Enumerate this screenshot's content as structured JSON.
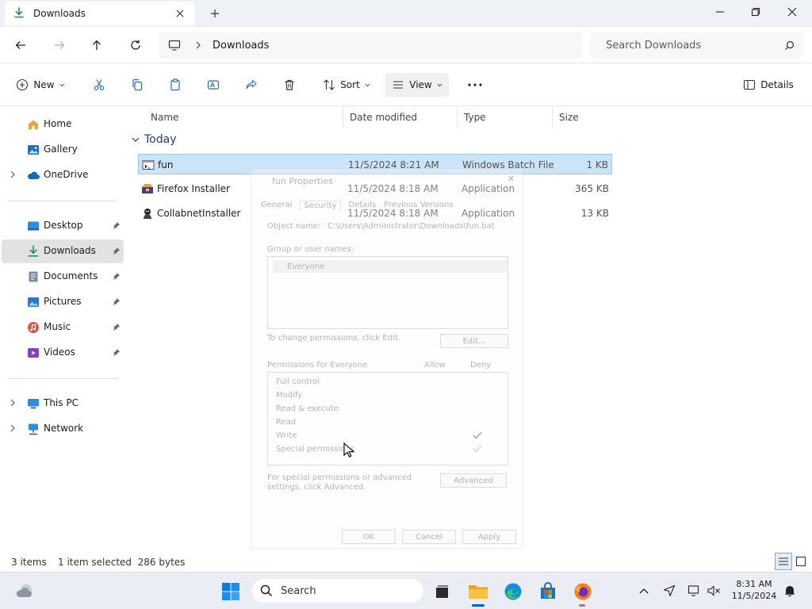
{
  "window": {
    "tab_title": "Downloads",
    "tab_icon": "downloads-arrow-icon",
    "controls": [
      "minimize-icon",
      "maximize-icon",
      "close-icon"
    ]
  },
  "address": {
    "breadcrumb": "Downloads",
    "search_placeholder": "Search Downloads"
  },
  "toolbar": {
    "new_label": "New",
    "sort_label": "Sort",
    "view_label": "View",
    "details_label": "Details"
  },
  "sidebar": {
    "quick": [
      {
        "label": "Home",
        "icon": "home-icon"
      },
      {
        "label": "Gallery",
        "icon": "gallery-icon"
      },
      {
        "label": "OneDrive",
        "icon": "onedrive-cloud-icon"
      }
    ],
    "pinned": [
      {
        "label": "Desktop",
        "icon": "desktop-icon"
      },
      {
        "label": "Downloads",
        "icon": "downloads-icon"
      },
      {
        "label": "Documents",
        "icon": "documents-icon"
      },
      {
        "label": "Pictures",
        "icon": "pictures-icon"
      },
      {
        "label": "Music",
        "icon": "music-icon"
      },
      {
        "label": "Videos",
        "icon": "videos-icon"
      }
    ],
    "devices": [
      {
        "label": "This PC",
        "icon": "this-pc-icon"
      },
      {
        "label": "Network",
        "icon": "network-icon"
      }
    ]
  },
  "filelist": {
    "columns": {
      "name": "Name",
      "date": "Date modified",
      "type": "Type",
      "size": "Size"
    },
    "group_label": "Today",
    "files": [
      {
        "name": "fun",
        "date": "11/5/2024 8:21 AM",
        "type": "Windows Batch File",
        "size": "1 KB"
      },
      {
        "name": "Firefox Installer",
        "date": "11/5/2024 8:18 AM",
        "type": "Application",
        "size": "365 KB"
      },
      {
        "name": "CollabnetInstaller",
        "date": "11/5/2024 8:18 AM",
        "type": "Application",
        "size": "13 KB"
      }
    ]
  },
  "dialog": {
    "title": "fun Properties",
    "tabs": [
      "General",
      "Security",
      "Details",
      "Previous Versions"
    ],
    "object_label": "Object name:",
    "object_path": "C:\\Users\\Administrator\\Downloads\\fun.bat",
    "group_label": "Group or user names:",
    "user_entry": "Everyone",
    "change_hint": "To change permissions, click Edit.",
    "edit_button": "Edit...",
    "permissions_label": "Permissions for Everyone",
    "allow_label": "Allow",
    "deny_label": "Deny",
    "permissions": [
      "Full control",
      "Modify",
      "Read & execute",
      "Read",
      "Write",
      "Special permissions"
    ],
    "special_hint": "For special permissions or advanced settings, click Advanced.",
    "advanced_button": "Advanced",
    "ok_button": "OK",
    "cancel_button": "Cancel",
    "apply_button": "Apply"
  },
  "status": {
    "item_count": "3 items",
    "selection": "1 item selected  286 bytes"
  },
  "taskbar": {
    "search_label": "Search",
    "time": "8:31 AM",
    "date": "11/5/2024"
  },
  "colors": {
    "selection_bg": "#cce4f7",
    "selection_border": "#99c9ef",
    "accent": "#0067c0",
    "folder_yellow": "#f5c245",
    "nav_selected": "#e2e2e2"
  }
}
